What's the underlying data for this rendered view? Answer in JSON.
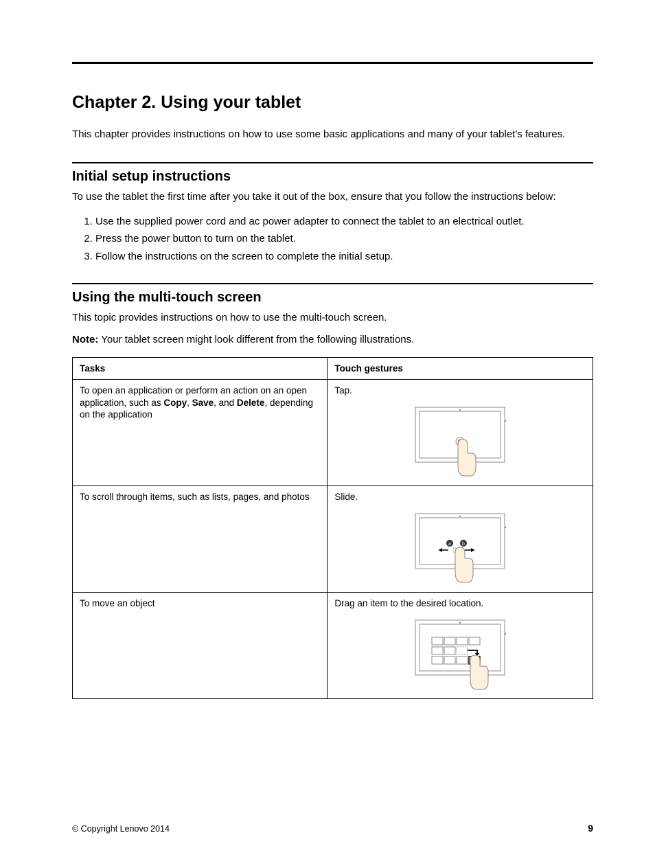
{
  "chapter": {
    "title": "Chapter 2.   Using your tablet",
    "intro": "This chapter provides instructions on how to use some basic applications and many of your tablet's features."
  },
  "section1": {
    "heading": "Initial setup instructions",
    "lead": "To use the tablet the first time after you take it out of the box, ensure that you follow the instructions below:",
    "steps": [
      "Use the supplied power cord and ac power adapter to connect the tablet to an electrical outlet.",
      "Press the power button to turn on the tablet.",
      "Follow the instructions on the screen to complete the initial setup."
    ]
  },
  "section2": {
    "heading": "Using the multi-touch screen",
    "lead": "This topic provides instructions on how to use the multi-touch screen.",
    "note_label": "Note:",
    "note_text": " Your tablet screen might look different from the following illustrations.",
    "table": {
      "col1": "Tasks",
      "col2": "Touch gestures",
      "rows": [
        {
          "task_pre": "To open an application or perform an action on an open application, such as ",
          "b1": "Copy",
          "c1": ", ",
          "b2": "Save",
          "c2": ", and ",
          "b3": "Delete",
          "task_post": ", depending on the application",
          "gesture": "Tap."
        },
        {
          "task": "To scroll through items, such as lists, pages, and photos",
          "gesture": "Slide."
        },
        {
          "task": "To move an object",
          "gesture": "Drag an item to the desired location."
        }
      ]
    }
  },
  "footer": {
    "copyright": "© Copyright Lenovo 2014",
    "page": "9"
  }
}
